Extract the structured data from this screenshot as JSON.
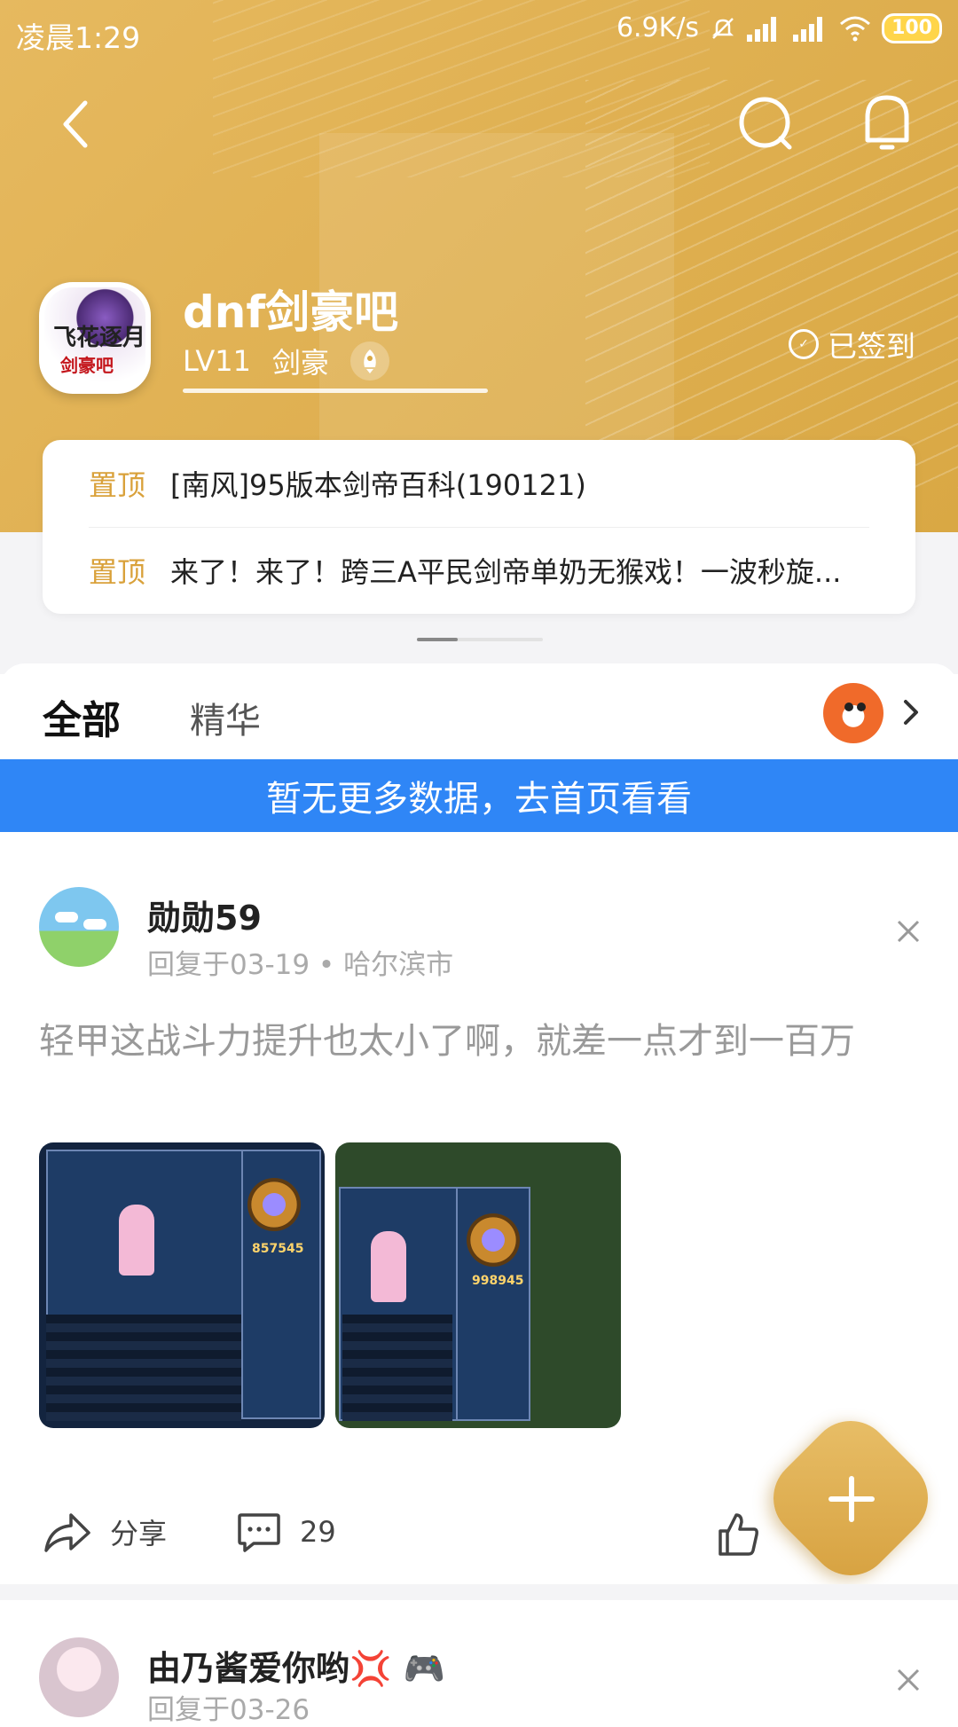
{
  "status_bar": {
    "time": "凌晨1:29",
    "network_speed": "6.9K/s",
    "battery": "100"
  },
  "forum": {
    "name": "dnf剑豪吧",
    "level": "LV11",
    "title": "剑豪",
    "level_progress": 0.0,
    "signed_label": "已签到",
    "logo_text_1": "飞花逐月",
    "logo_text_2": "剑豪吧"
  },
  "top_posts": [
    {
      "tag": "置顶",
      "title": "[南风]95版本剑帝百科(190121)"
    },
    {
      "tag": "置顶",
      "title": "来了！来了！跨三A平民剑帝单奶无猴戏！一波秒旋..."
    }
  ],
  "tabs": [
    {
      "label": "全部",
      "active": true
    },
    {
      "label": "精华",
      "active": false
    }
  ],
  "banner": {
    "text": "暂无更多数据，去首页看看",
    "color": "#2f86f6"
  },
  "post": {
    "author": "勋勋59",
    "meta": "回复于03-19 • 哈尔滨市",
    "text": "轻甲这战斗力提升也太小了啊，就差一点才到一百万",
    "image1_score": "857545",
    "image2_score": "998945",
    "share_label": "分享",
    "comment_count": "29"
  },
  "post2": {
    "author": "由乃酱爱你哟💢 🎮",
    "meta": "回复于03-26"
  },
  "colors": {
    "header_gold": "#e0b153",
    "tag_gold": "#d9a13a",
    "accent_blue": "#2f86f6"
  }
}
